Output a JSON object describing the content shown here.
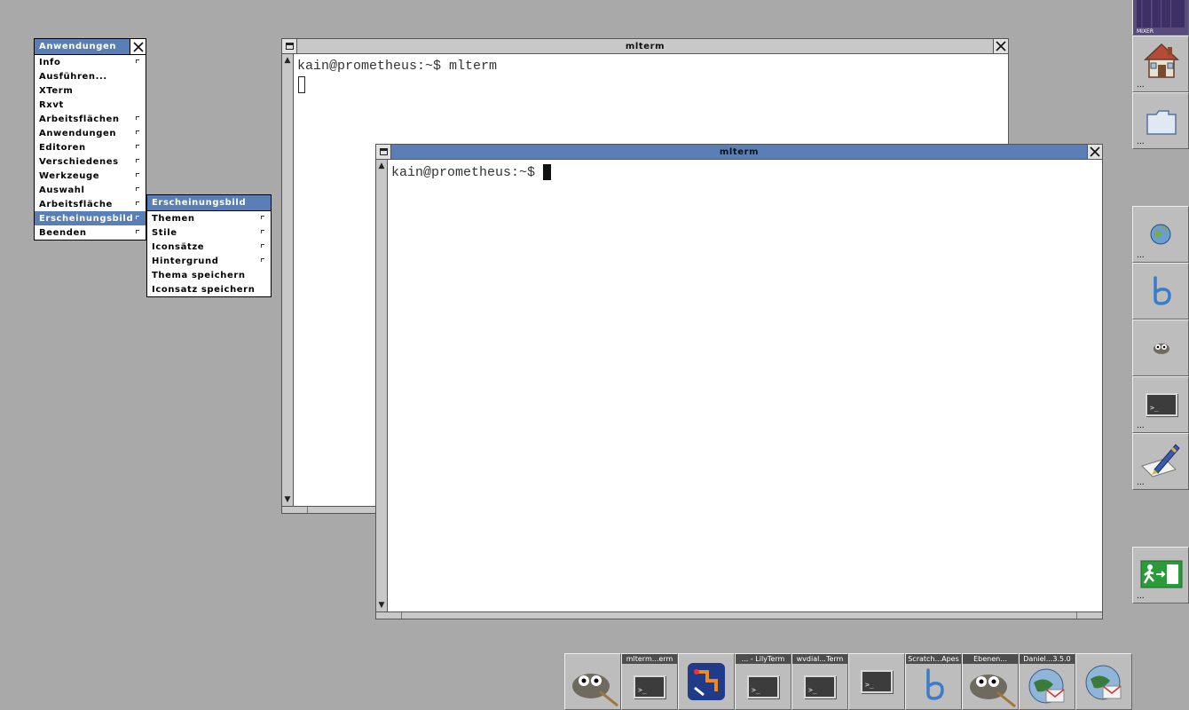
{
  "main_menu": {
    "title": "Anwendungen",
    "items": [
      {
        "label": "Info",
        "sub": true
      },
      {
        "label": "Ausführen...",
        "sub": false
      },
      {
        "label": "XTerm",
        "sub": false
      },
      {
        "label": "Rxvt",
        "sub": false
      },
      {
        "label": "Arbeitsflächen",
        "sub": true
      },
      {
        "label": "Anwendungen",
        "sub": true
      },
      {
        "label": "Editoren",
        "sub": true
      },
      {
        "label": "Verschiedenes",
        "sub": true
      },
      {
        "label": "Werkzeuge",
        "sub": true
      },
      {
        "label": "Auswahl",
        "sub": true
      },
      {
        "label": "Arbeitsfläche",
        "sub": true
      },
      {
        "label": "Erscheinungsbild",
        "sub": true,
        "selected": true
      },
      {
        "label": "Beenden",
        "sub": true
      }
    ]
  },
  "sub_menu": {
    "title": "Erscheinungsbild",
    "items": [
      {
        "label": "Themen",
        "sub": true
      },
      {
        "label": "Stile",
        "sub": true
      },
      {
        "label": "Iconsätze",
        "sub": true
      },
      {
        "label": "Hintergrund",
        "sub": true
      },
      {
        "label": "Thema speichern",
        "sub": false
      },
      {
        "label": "Iconsatz speichern",
        "sub": false
      }
    ]
  },
  "window_back": {
    "title": "mlterm",
    "line1": "kain@prometheus:~$ mlterm"
  },
  "window_front": {
    "title": "mlterm",
    "line1": "kain@prometheus:~$ "
  },
  "dock": {
    "mixer_label": "MIXER",
    "ellipsis": "..."
  },
  "taskbar": {
    "labels": [
      "mlterm...erm",
      "... - LilyTerm",
      "wvdial...Term",
      "Scratch...Apes",
      "Ebenen...",
      "Daniel...3.5.0"
    ]
  },
  "colors": {
    "accent": "#5a7fb6",
    "desktop": "#a9a9a9",
    "titlebar_inactive": "#c8c8c8"
  }
}
